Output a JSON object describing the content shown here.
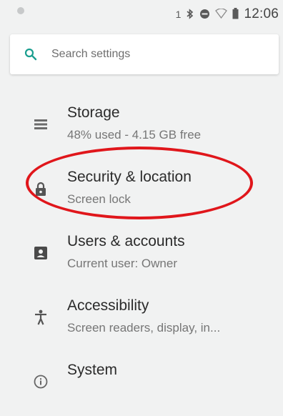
{
  "status_bar": {
    "time": "12:06",
    "icons": [
      "notification-dot-icon",
      "sim-1-icon",
      "bluetooth-icon",
      "dnd-icon",
      "wifi-icon",
      "battery-icon"
    ],
    "sim_label": "1"
  },
  "search": {
    "placeholder": "Search settings",
    "accent_color": "#1a9e8f"
  },
  "settings": {
    "items": [
      {
        "title": "Storage",
        "subtitle": "48% used - 4.15 GB free",
        "icon": "storage-icon"
      },
      {
        "title": "Security & location",
        "subtitle": "Screen lock",
        "icon": "lock-icon"
      },
      {
        "title": "Users & accounts",
        "subtitle": "Current user: Owner",
        "icon": "account-box-icon"
      },
      {
        "title": "Accessibility",
        "subtitle": "Screen readers, display, in...",
        "icon": "accessibility-icon"
      },
      {
        "title": "System",
        "subtitle": "",
        "icon": "info-icon"
      }
    ]
  },
  "annotation": {
    "color": "#e0161b",
    "target": "Security & location"
  }
}
